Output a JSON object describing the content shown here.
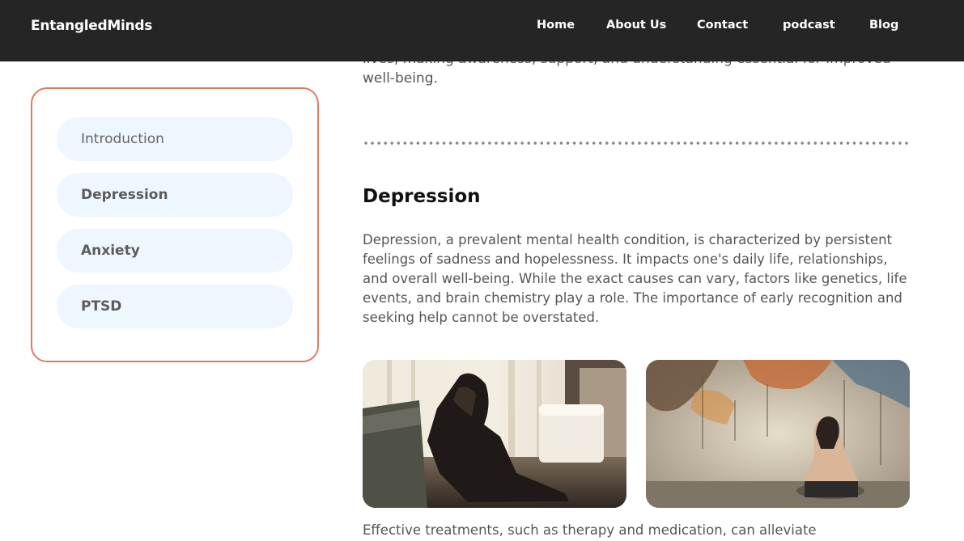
{
  "brand": "EntangledMinds",
  "nav": {
    "items": [
      {
        "label": "Home"
      },
      {
        "label": "About Us"
      },
      {
        "label": "Contact"
      },
      {
        "label": "podcast"
      },
      {
        "label": "Blog"
      }
    ]
  },
  "toc": {
    "items": [
      {
        "label": "Introduction"
      },
      {
        "label": "Depression"
      },
      {
        "label": "Anxiety"
      },
      {
        "label": "PTSD"
      }
    ]
  },
  "intro": {
    "text": "Mental health issues, often misunderstood, can profoundly impact individuals' lives, making awareness, support, and understanding essential for improved well-being."
  },
  "depression": {
    "title": "Depression",
    "text": "Depression, a prevalent mental health condition, is characterized by persistent feelings of sadness and hopelessness. It impacts one's daily life, relationships, and overall well-being. While the exact causes can vary, factors like genetics, life events, and brain chemistry play a role. The importance of early recognition and seeking help cannot be overstated.",
    "after_text": "Effective treatments, such as therapy and medication, can alleviate"
  },
  "colors": {
    "navbar_bg": "#252525",
    "toc_border": "#e07a5f",
    "toc_item_bg": "#eef6ff",
    "body_text": "#555555"
  }
}
